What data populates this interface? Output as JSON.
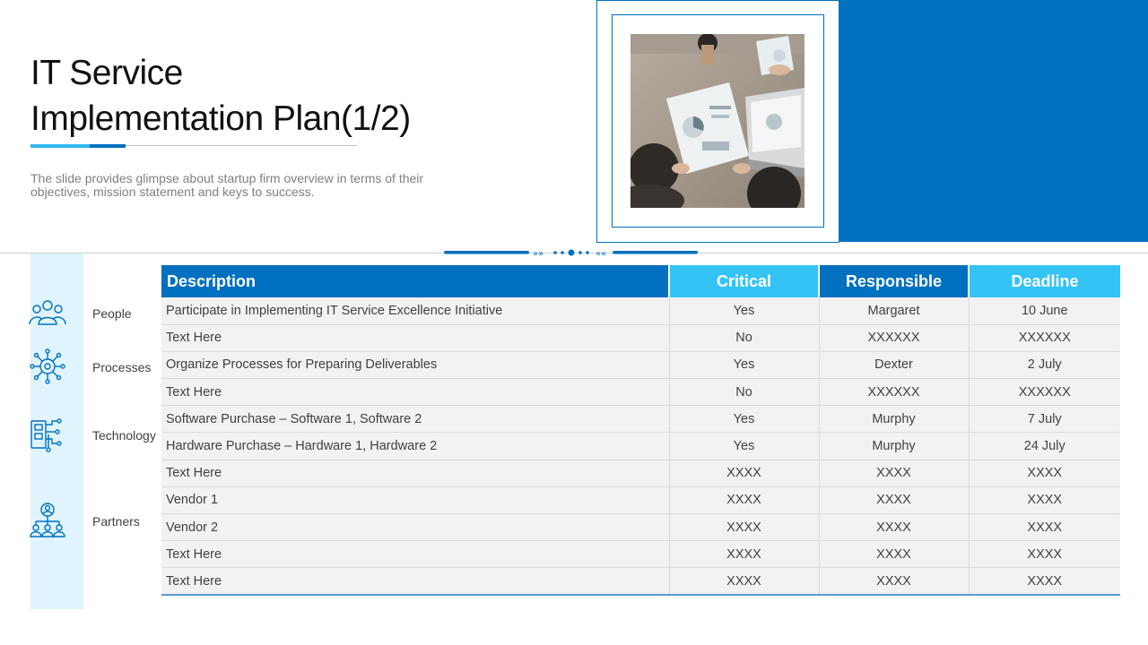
{
  "slide": {
    "title_line1": "IT Service",
    "title_line2": "Implementation Plan(1/2)",
    "subtitle": "The slide provides glimpse about startup firm overview in terms of their objectives, mission statement and keys to success."
  },
  "side": {
    "items": [
      {
        "label": "People",
        "icon": "people-group-icon"
      },
      {
        "label": "Processes",
        "icon": "gear-network-icon"
      },
      {
        "label": "Technology",
        "icon": "circuit-device-icon"
      },
      {
        "label": "Partners",
        "icon": "org-hierarchy-icon"
      }
    ]
  },
  "table": {
    "headers": [
      "Description",
      "Critical",
      "Responsible",
      "Deadline"
    ],
    "rows": [
      [
        "Participate in Implementing IT Service Excellence Initiative",
        "Yes",
        "Margaret",
        "10 June"
      ],
      [
        "Text Here",
        "No",
        "XXXXXX",
        "XXXXXX"
      ],
      [
        "Organize Processes for Preparing Deliverables",
        "Yes",
        "Dexter",
        "2 July"
      ],
      [
        "Text Here",
        "No",
        "XXXXXX",
        "XXXXXX"
      ],
      [
        "Software Purchase – Software 1, Software 2",
        "Yes",
        "Murphy",
        "7 July"
      ],
      [
        "Hardware Purchase – Hardware 1, Hardware 2",
        "Yes",
        "Murphy",
        "24 July"
      ],
      [
        "Text Here",
        "XXXX",
        "XXXX",
        "XXXX"
      ],
      [
        "Vendor 1",
        "XXXX",
        "XXXX",
        "XXXX"
      ],
      [
        "Vendor 2",
        "XXXX",
        "XXXX",
        "XXXX"
      ],
      [
        "Text Here",
        "XXXX",
        "XXXX",
        "XXXX"
      ],
      [
        "Text Here",
        "XXXX",
        "XXXX",
        "XXXX"
      ]
    ]
  },
  "colors": {
    "primary_blue": "#0070c0",
    "light_blue": "#33c4f5",
    "panel_blue": "#dff4fd"
  }
}
